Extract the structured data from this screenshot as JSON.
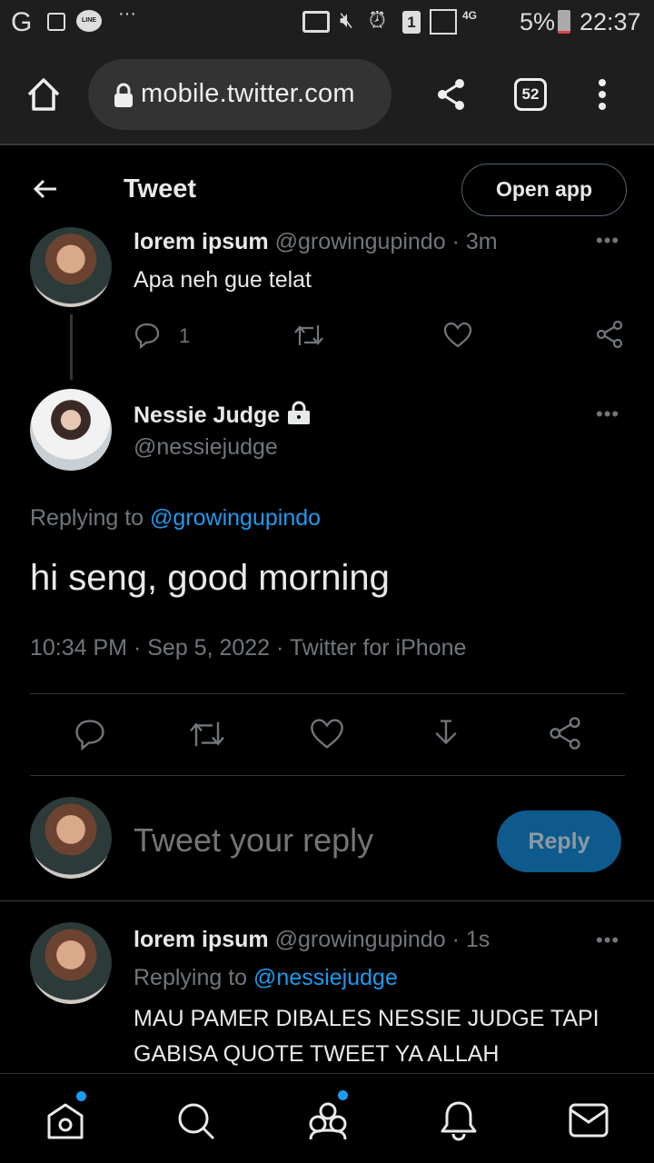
{
  "status_bar": {
    "time": "22:37",
    "battery": "5%",
    "network": "4G",
    "sim": "1",
    "icons": [
      "google-icon",
      "gallery-icon",
      "line-icon",
      "more-notifications-icon",
      "cast-icon",
      "mute-icon",
      "alarm-icon",
      "sim-icon",
      "signal-icon",
      "battery-icon"
    ]
  },
  "browser": {
    "url": "mobile.twitter.com",
    "tab_count": "52"
  },
  "header": {
    "title": "Tweet",
    "open_app": "Open app"
  },
  "parent_tweet": {
    "name": "lorem ipsum",
    "handle": "@growingupindo",
    "time": "3m",
    "text": "Apa neh gue telat",
    "reply_count": "1"
  },
  "main_tweet": {
    "name": "Nessie Judge",
    "handle": "@nessiejudge",
    "replying_label": "Replying to",
    "replying_to": "@growingupindo",
    "text": "hi seng, good morning",
    "time": "10:34 PM",
    "date": "Sep 5, 2022",
    "source": "Twitter for iPhone"
  },
  "composer": {
    "placeholder": "Tweet your reply",
    "button": "Reply"
  },
  "reply_tweet": {
    "name": "lorem ipsum",
    "handle": "@growingupindo",
    "time": "1s",
    "replying_label": "Replying to",
    "replying_to": "@nessiejudge",
    "text": "MAU PAMER DIBALES NESSIE JUDGE TAPI GABISA QUOTE TWEET YA ALLAH"
  },
  "separator": "·",
  "colors": {
    "accent": "#1d9bf0",
    "reply_button": "#0e5a8c",
    "background": "#000000"
  }
}
